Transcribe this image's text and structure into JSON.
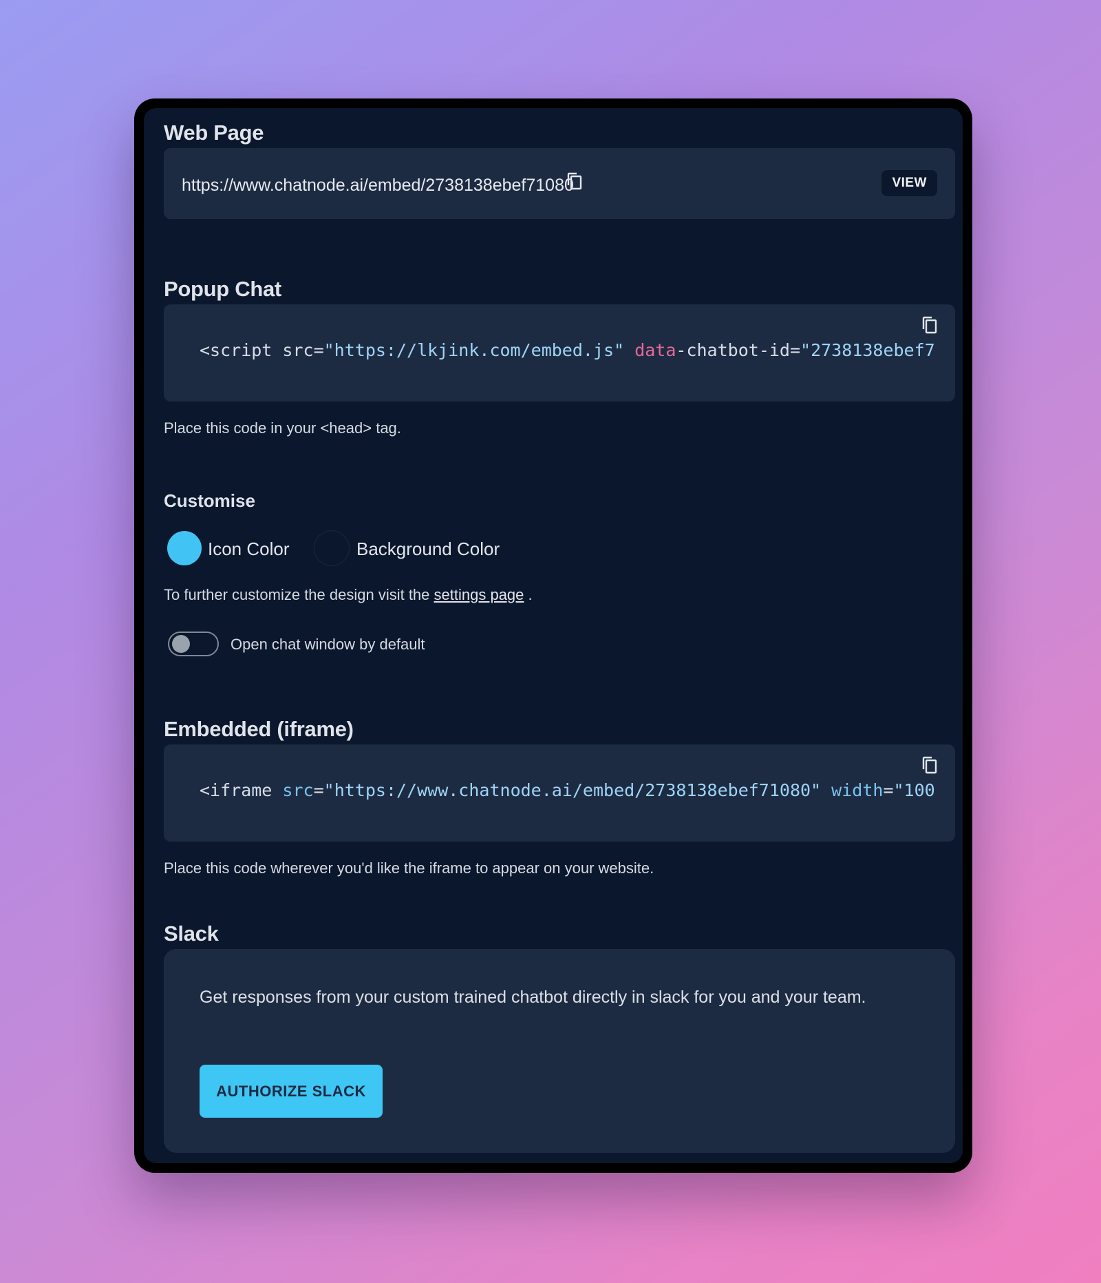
{
  "web_page": {
    "title": "Web Page",
    "url": "https://www.chatnode.ai/embed/2738138ebef71080",
    "copy_icon": "copy-icon",
    "view_label": "VIEW"
  },
  "popup_chat": {
    "title": "Popup Chat",
    "code": {
      "part1": "<script src=",
      "part2": "\"https://lkjink.com/embed.js\"",
      "part3": " ",
      "part4": "data",
      "part5": "-chatbot-id=",
      "part6": "\"2738138ebef7"
    },
    "copy_icon": "copy-icon",
    "help": "Place this code in your <head> tag."
  },
  "customise": {
    "title": "Customise",
    "icon_color_label": "Icon Color",
    "icon_color": "#41c3f4",
    "background_color_label": "Background Color",
    "background_color": "#0b172c",
    "further_text": "To further customize the design visit the ",
    "settings_link": "settings page",
    "further_end": " .",
    "toggle_label": "Open chat window by default",
    "toggle_on": false
  },
  "iframe": {
    "title": "Embedded (iframe)",
    "code": {
      "part1": "<iframe ",
      "part2": "src",
      "part3": "=",
      "part4": "\"https://www.chatnode.ai/embed/2738138ebef71080\"",
      "part5": " ",
      "part6": "width",
      "part7": "=",
      "part8": "\"100"
    },
    "copy_icon": "copy-icon",
    "help": "Place this code wherever you'd like the iframe to appear on your website."
  },
  "slack": {
    "title": "Slack",
    "description": "Get responses from your custom trained chatbot directly in slack for you and your team.",
    "button": "AUTHORIZE SLACK"
  },
  "colors": {
    "accent": "#41c3f4",
    "panel": "#1d2b42",
    "background": "#0b172c"
  }
}
